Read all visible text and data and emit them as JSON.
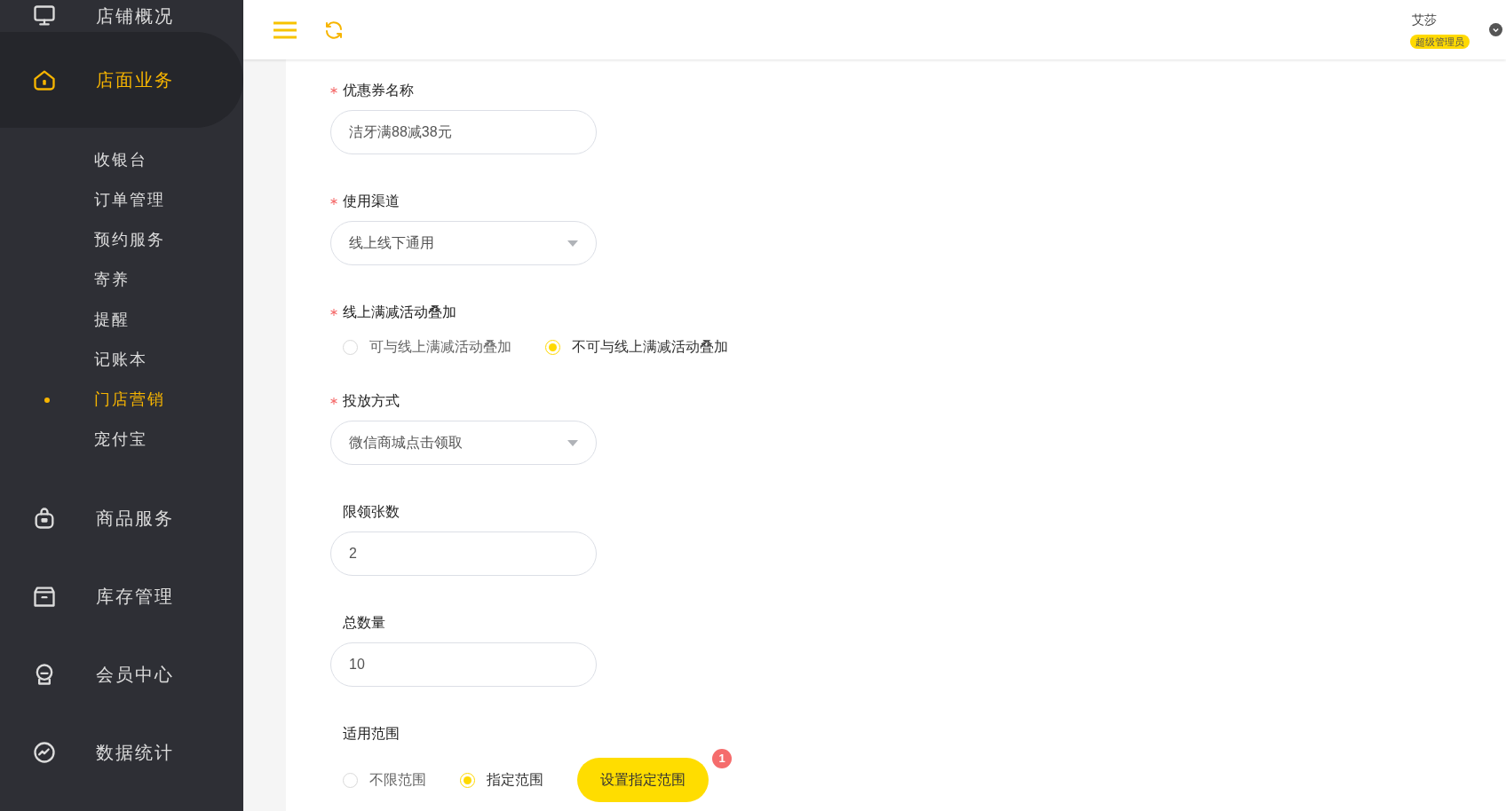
{
  "sidebar": {
    "items": [
      {
        "label": "店铺概况",
        "selected": false
      },
      {
        "label": "店面业务",
        "selected": true,
        "children": [
          {
            "label": "收银台",
            "selected": false
          },
          {
            "label": "订单管理",
            "selected": false
          },
          {
            "label": "预约服务",
            "selected": false
          },
          {
            "label": "寄养",
            "selected": false
          },
          {
            "label": "提醒",
            "selected": false
          },
          {
            "label": "记账本",
            "selected": false
          },
          {
            "label": "门店营销",
            "selected": true
          },
          {
            "label": "宠付宝",
            "selected": false
          }
        ]
      },
      {
        "label": "商品服务",
        "selected": false
      },
      {
        "label": "库存管理",
        "selected": false
      },
      {
        "label": "会员中心",
        "selected": false
      },
      {
        "label": "数据统计",
        "selected": false
      }
    ]
  },
  "header": {
    "user": {
      "name": "艾莎",
      "role": "超级管理员"
    }
  },
  "form": {
    "fields": [
      {
        "kind": "text",
        "label": "优惠券名称",
        "required": true,
        "value": "洁牙满88减38元"
      },
      {
        "kind": "select",
        "label": "使用渠道",
        "required": true,
        "value": "线上线下通用"
      },
      {
        "kind": "radio",
        "label": "线上满减活动叠加",
        "required": true,
        "options": [
          {
            "label": "可与线上满减活动叠加",
            "selected": false
          },
          {
            "label": "不可与线上满减活动叠加",
            "selected": true
          }
        ]
      },
      {
        "kind": "select",
        "label": "投放方式",
        "required": true,
        "value": "微信商城点击领取"
      },
      {
        "kind": "text",
        "label": "限领张数",
        "required": false,
        "value": "2"
      },
      {
        "kind": "text",
        "label": "总数量",
        "required": false,
        "value": "10"
      },
      {
        "kind": "radio",
        "label": "适用范围",
        "required": false,
        "options": [
          {
            "label": "不限范围",
            "selected": false
          },
          {
            "label": "指定范围",
            "selected": true
          }
        ],
        "button": {
          "label": "设置指定范围",
          "badge": "1"
        }
      }
    ]
  }
}
